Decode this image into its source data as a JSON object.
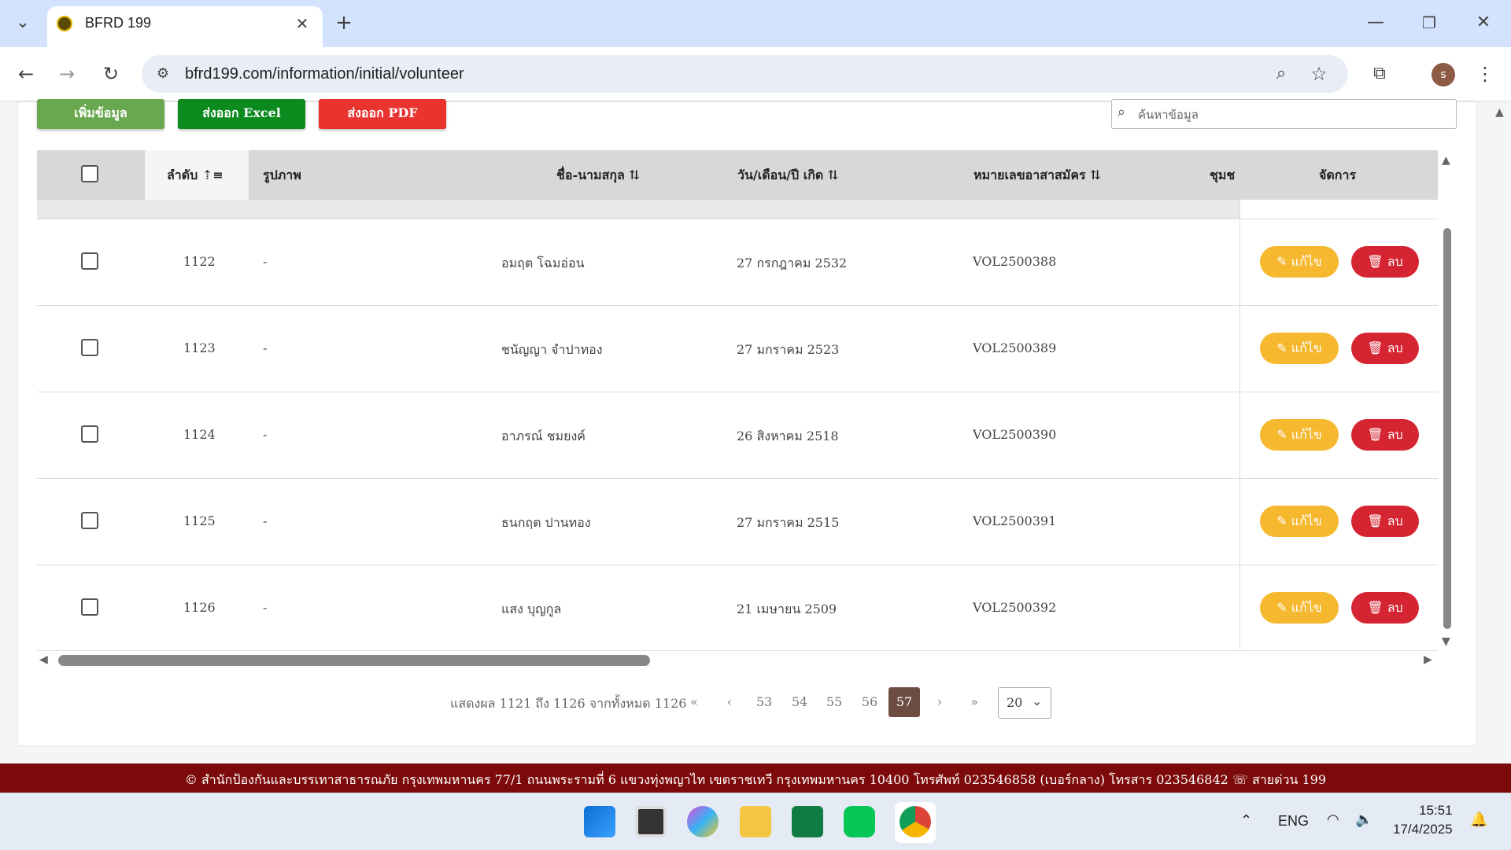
{
  "browser": {
    "tab_title": "BFRD 199",
    "url": "bfrd199.com/information/initial/volunteer",
    "new_tab": "+",
    "avatar_initial": "s"
  },
  "toolbar": {
    "add_label": "เพิ่มข้อมูล",
    "excel_label": "ส่งออก Excel",
    "pdf_label": "ส่งออก PDF",
    "search_placeholder": "ค้นหาข้อมูล"
  },
  "table": {
    "headers": {
      "order": "ลำดับ",
      "photo": "รูปภาพ",
      "name": "ชื่อ-นามสกุล",
      "dob": "วัน/เดือน/ปี เกิด",
      "vol_id": "หมายเลขอาสาสมัคร",
      "community": "ชุมช",
      "manage": "จัดการ"
    },
    "edit_label": "แก้ไข",
    "delete_label": "ลบ",
    "rows": [
      {
        "order": "1122",
        "photo": "-",
        "name": "อมฤต โฉมอ่อน",
        "dob": "27 กรกฎาคม 2532",
        "vol_id": "VOL2500388"
      },
      {
        "order": "1123",
        "photo": "-",
        "name": "ชนัญญา จำปาทอง",
        "dob": "27 มกราคม 2523",
        "vol_id": "VOL2500389"
      },
      {
        "order": "1124",
        "photo": "-",
        "name": "อาภรณ์ ชมยงค์",
        "dob": "26 สิงหาคม 2518",
        "vol_id": "VOL2500390"
      },
      {
        "order": "1125",
        "photo": "-",
        "name": "ธนกฤต ปานทอง",
        "dob": "27 มกราคม 2515",
        "vol_id": "VOL2500391"
      },
      {
        "order": "1126",
        "photo": "-",
        "name": "แสง บุญกูล",
        "dob": "21 เมษายน 2509",
        "vol_id": "VOL2500392"
      }
    ]
  },
  "pagination": {
    "summary": "แสดงผล 1121 ถึง 1126 จากทั้งหมด 1126",
    "first": "«",
    "prev": "‹",
    "pages": [
      "53",
      "54",
      "55",
      "56",
      "57"
    ],
    "active": "57",
    "next": "›",
    "last": "»",
    "page_size": "20"
  },
  "footer": {
    "text": "© สำนักป้องกันและบรรเทาสาธารณภัย กรุงเทพมหานคร 77/1 ถนนพระรามที่ 6 แขวงทุ่งพญาไท เขตราชเทวี กรุงเทพมหานคร 10400 โทรศัพท์ 023546858 (เบอร์กลาง) โทรสาร 023546842",
    "hotline": "สายด่วน 199"
  },
  "taskbar": {
    "lang": "ENG",
    "time": "15:51",
    "date": "17/4/2025"
  }
}
